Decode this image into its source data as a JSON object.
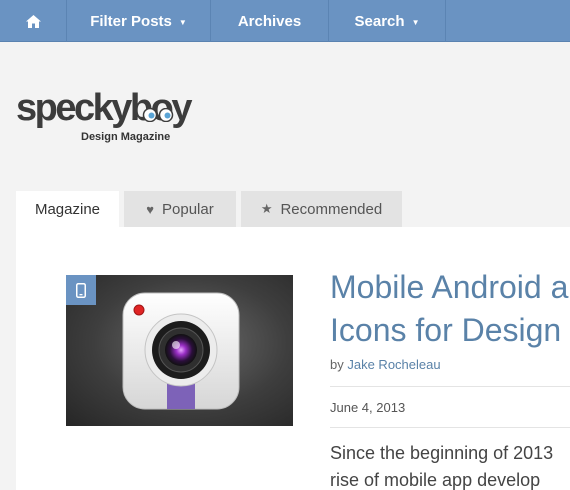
{
  "nav": {
    "home_icon": "home-icon",
    "items": [
      {
        "label": "Filter Posts",
        "has_dropdown": true
      },
      {
        "label": "Archives",
        "has_dropdown": false
      },
      {
        "label": "Search",
        "has_dropdown": true
      }
    ],
    "caret": "▼"
  },
  "logo": {
    "word_part1": "specky",
    "word_part2": "boy",
    "tagline": "Design Magazine"
  },
  "tabs": [
    {
      "label": "Magazine",
      "icon": "",
      "active": true
    },
    {
      "label": "Popular",
      "icon": "heart-icon",
      "glyph": "♥",
      "active": false
    },
    {
      "label": "Recommended",
      "icon": "star-icon",
      "glyph": "★",
      "active": false
    }
  ],
  "article": {
    "category_icon": "mobile-icon",
    "title_line1": "Mobile Android a",
    "title_line2": "Icons for Design",
    "by_prefix": "by",
    "author": "Jake Rocheleau",
    "date": "June 4, 2013",
    "excerpt_line1": "Since the beginning of 2013",
    "excerpt_line2": "rise of mobile app develop"
  },
  "colors": {
    "nav_bg": "#6a93c2",
    "accent_link": "#5a82a8",
    "page_bg": "#f3f3f3"
  }
}
